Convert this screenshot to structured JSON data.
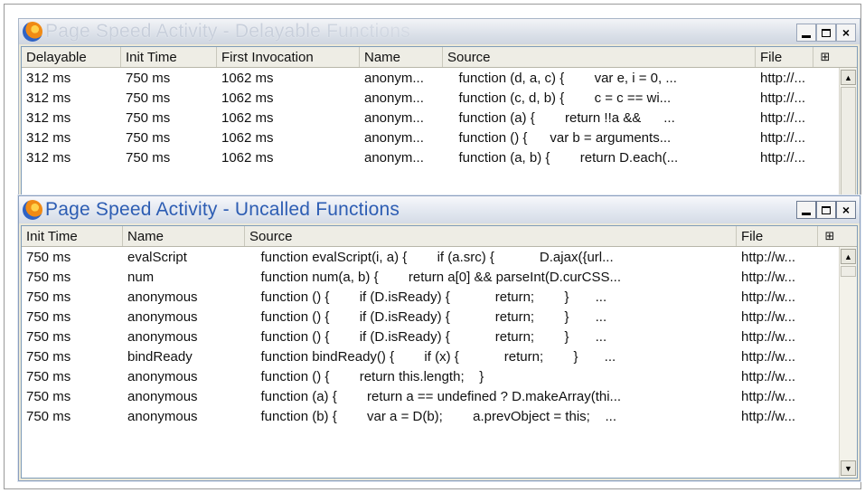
{
  "back_window": {
    "title": "Page Speed Activity - Delayable Functions",
    "columns": [
      "Delayable",
      "Init Time",
      "First Invocation",
      "Name",
      "Source",
      "File"
    ],
    "rows": [
      [
        "312 ms",
        "750 ms",
        "1062 ms",
        "anonym...",
        "   function (d, a, c) {        var e, i = 0, ...",
        "http://..."
      ],
      [
        "312 ms",
        "750 ms",
        "1062 ms",
        "anonym...",
        "   function (c, d, b) {        c = c == wi...",
        "http://..."
      ],
      [
        "312 ms",
        "750 ms",
        "1062 ms",
        "anonym...",
        "   function (a) {        return !!a &&      ...",
        "http://..."
      ],
      [
        "312 ms",
        "750 ms",
        "1062 ms",
        "anonym...",
        "   function () {      var b = arguments...",
        "http://..."
      ],
      [
        "312 ms",
        "750 ms",
        "1062 ms",
        "anonym...",
        "   function (a, b) {        return D.each(...",
        "http://..."
      ]
    ]
  },
  "front_window": {
    "title": "Page Speed Activity - Uncalled Functions",
    "columns": [
      "Init Time",
      "Name",
      "Source",
      "File"
    ],
    "rows": [
      [
        "750 ms",
        "evalScript",
        "   function evalScript(i, a) {        if (a.src) {            D.ajax({url...",
        "http://w..."
      ],
      [
        "750 ms",
        "num",
        "   function num(a, b) {        return a[0] && parseInt(D.curCSS...",
        "http://w..."
      ],
      [
        "750 ms",
        "anonymous",
        "   function () {        if (D.isReady) {            return;        }       ...",
        "http://w..."
      ],
      [
        "750 ms",
        "anonymous",
        "   function () {        if (D.isReady) {            return;        }       ...",
        "http://w..."
      ],
      [
        "750 ms",
        "anonymous",
        "   function () {        if (D.isReady) {            return;        }       ...",
        "http://w..."
      ],
      [
        "750 ms",
        "bindReady",
        "   function bindReady() {        if (x) {            return;        }       ...",
        "http://w..."
      ],
      [
        "750 ms",
        "anonymous",
        "   function () {        return this.length;    }",
        "http://w..."
      ],
      [
        "750 ms",
        "anonymous",
        "   function (a) {        return a == undefined ? D.makeArray(thi...",
        "http://w..."
      ],
      [
        "750 ms",
        "anonymous",
        "   function (b) {        var a = D(b);        a.prevObject = this;    ...",
        "http://w..."
      ]
    ]
  },
  "controls": {
    "minimize": "_",
    "maximize": "□",
    "close": "×"
  },
  "icons": {
    "app": "firefox-icon",
    "column_picker": "column-picker-icon"
  }
}
